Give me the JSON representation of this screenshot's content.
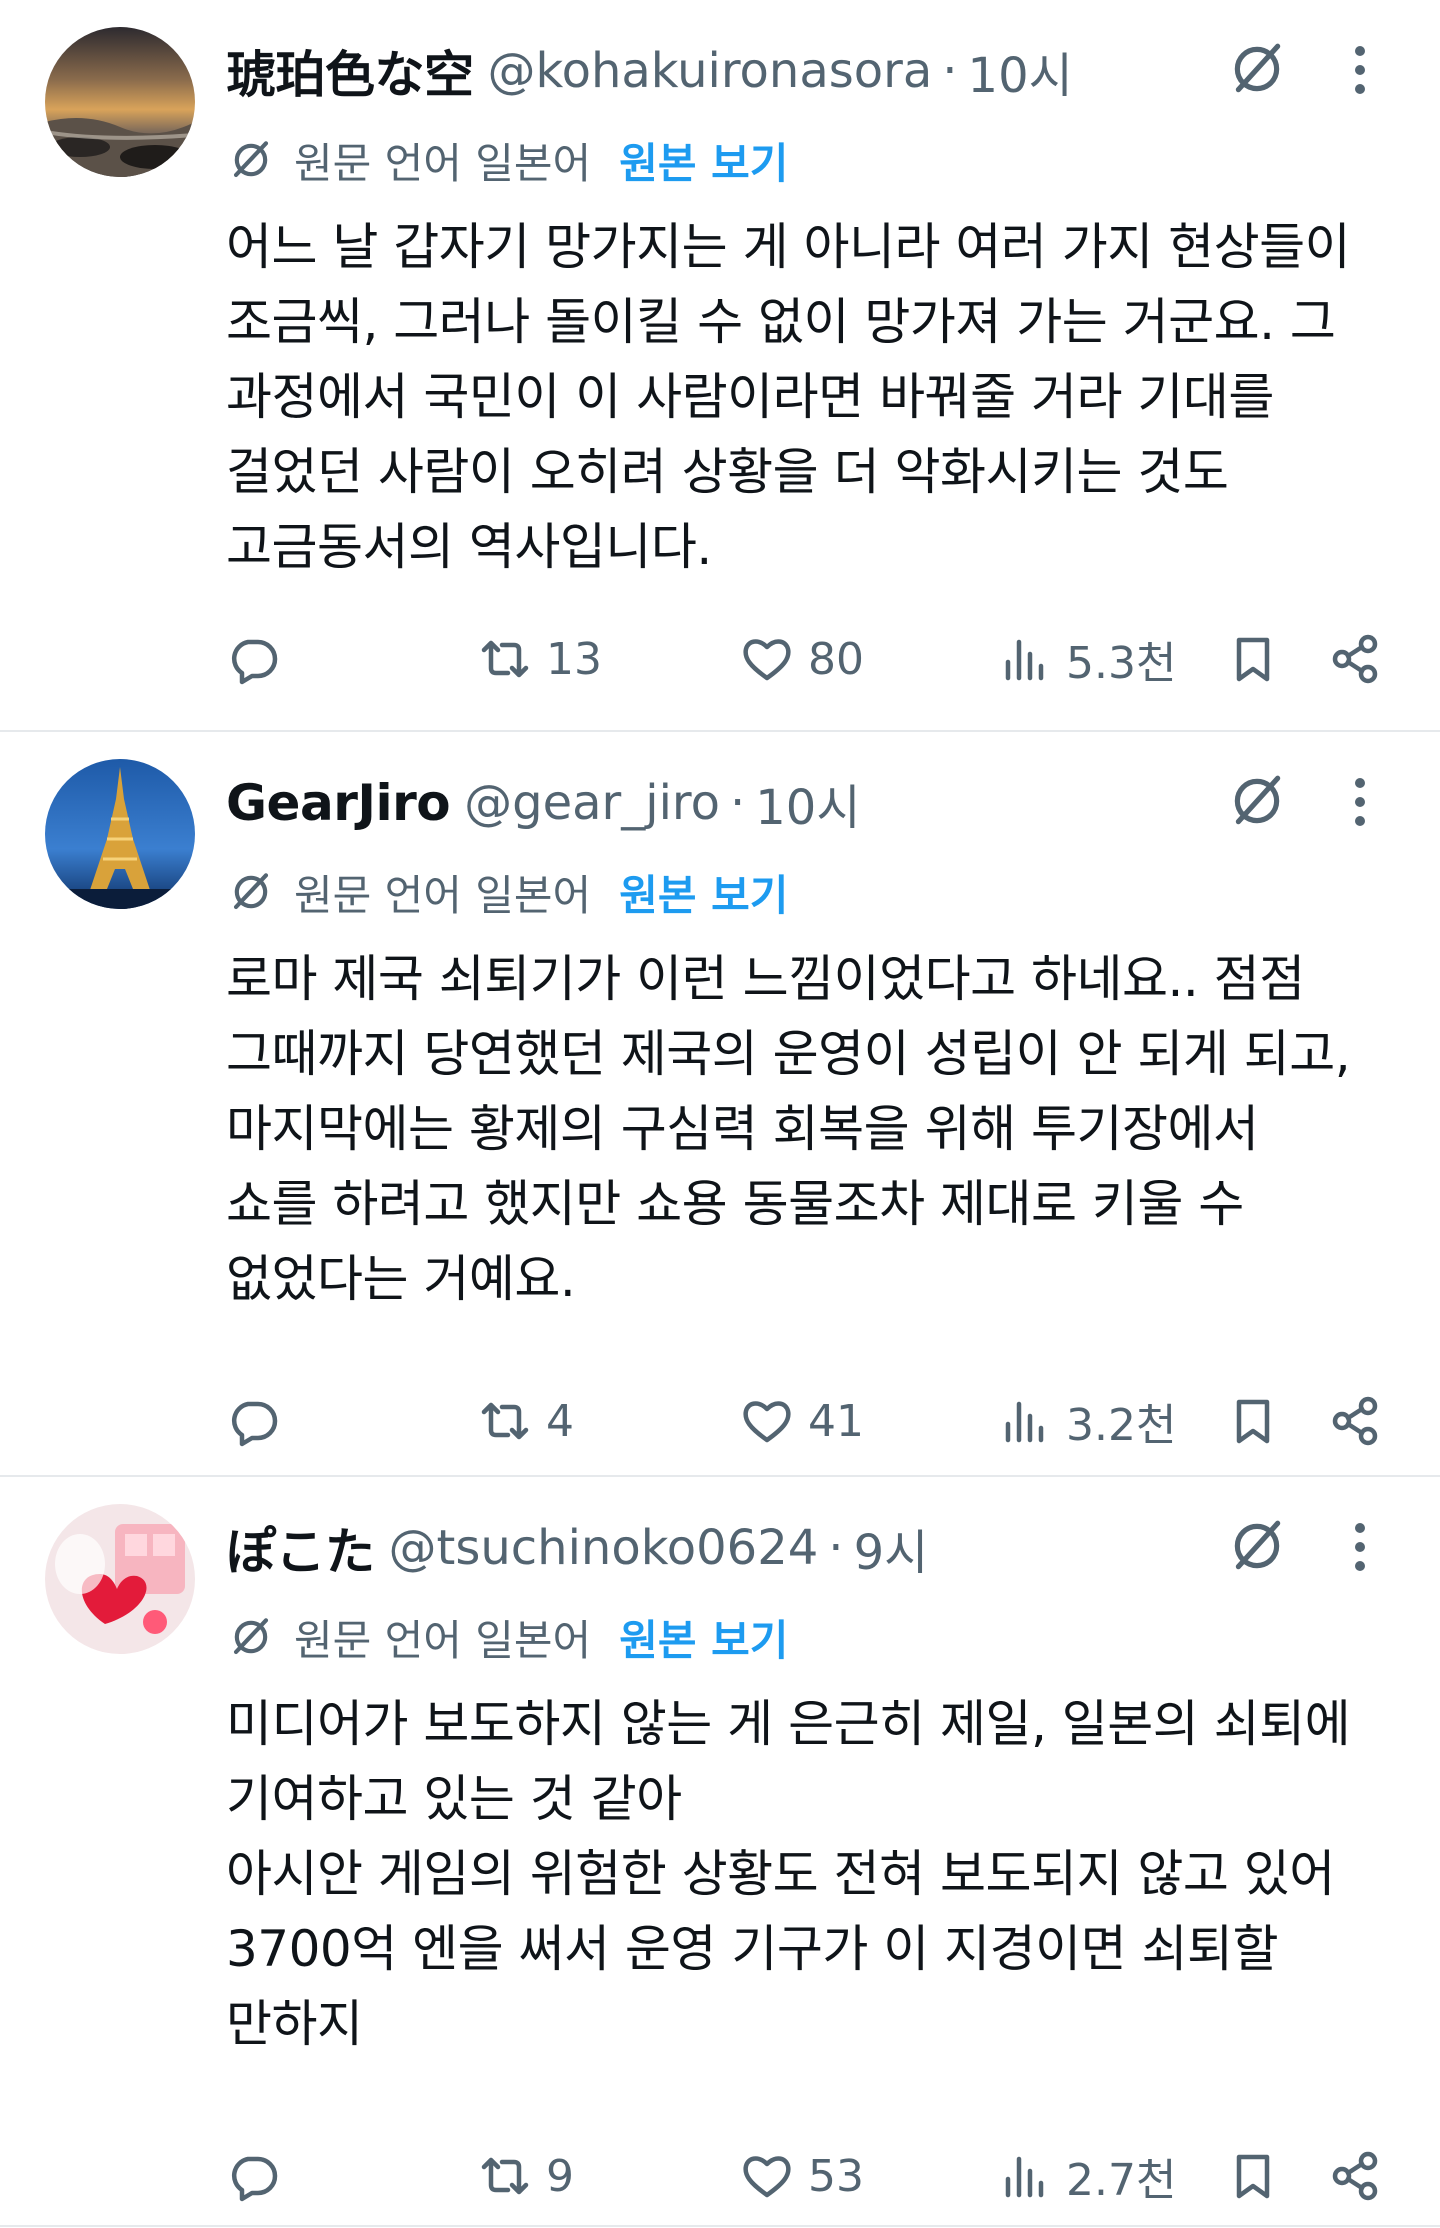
{
  "tweets": [
    {
      "display_name": "琥珀色な空",
      "handle": "@kohakuironasora",
      "separator": "·",
      "time": "10시",
      "translate_note": "원문 언어 일본어",
      "view_original": "원본 보기",
      "text": "어느 날 갑자기 망가지는 게 아니라 여러 가지 현상들이\n조금씩, 그러나 돌이킬 수 없이 망가져 가는 거군요. 그\n과정에서 국민이 이 사람이라면 바꿔줄 거라 기대를\n걸었던 사람이 오히려 상황을 더 악화시키는 것도\n고금동서의 역사입니다.",
      "retweets": "13",
      "likes": "80",
      "views": "5.3천"
    },
    {
      "display_name": "GearJiro",
      "handle": "@gear_jiro",
      "separator": "·",
      "time": "10시",
      "translate_note": "원문 언어 일본어",
      "view_original": "원본 보기",
      "text": "로마 제국 쇠퇴기가 이런 느낌이었다고 하네요.. 점점\n그때까지 당연했던 제국의 운영이 성립이 안 되게 되고,\n마지막에는 황제의 구심력 회복을 위해 투기장에서\n쇼를 하려고 했지만 쇼용 동물조차 제대로 키울 수\n없었다는 거예요.",
      "retweets": "4",
      "likes": "41",
      "views": "3.2천"
    },
    {
      "display_name": "ぽこた",
      "handle": "@tsuchinoko0624",
      "separator": "·",
      "time": "9시",
      "translate_note": "원문 언어 일본어",
      "view_original": "원본 보기",
      "text": "미디어가 보도하지 않는 게 은근히 제일, 일본의 쇠퇴에\n기여하고 있는 것 같아\n아시안 게임의 위험한 상황도 전혀 보도되지 않고 있어\n3700억 엔을 써서 운영 기구가 이 지경이면 쇠퇴할\n만하지",
      "retweets": "9",
      "likes": "53",
      "views": "2.7천"
    }
  ],
  "colors": {
    "accent": "#1d9bf0",
    "secondary_text": "#536471",
    "divider": "#e6e9ec"
  }
}
